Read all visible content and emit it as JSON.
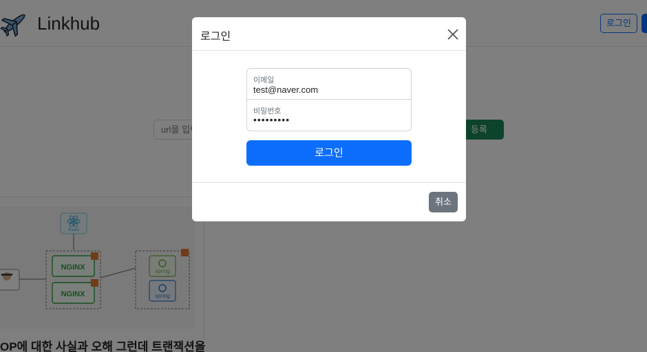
{
  "header": {
    "brand": "Linkhub",
    "logo_icon": "airplane-icon",
    "login_label": "로그인"
  },
  "main": {
    "url_placeholder": "url을 입력",
    "register_label": "등록",
    "card": {
      "title": "OP에 대한 사실과 오해 그런데 트랜잭션을",
      "diagram": {
        "react_label": "React",
        "nginx_label": "NGINX",
        "spring_label": "spring"
      }
    }
  },
  "modal": {
    "title": "로그인",
    "close_icon": "close-icon",
    "email": {
      "label": "이메일",
      "value": "test@naver.com"
    },
    "password": {
      "label": "비밀번호",
      "value": "•••••••••"
    },
    "submit_label": "로그인",
    "cancel_label": "취소"
  },
  "colors": {
    "primary": "#0d6efd",
    "success": "#198754",
    "secondary": "#6c757d",
    "backdrop": "rgba(0,0,0,0.5)"
  }
}
